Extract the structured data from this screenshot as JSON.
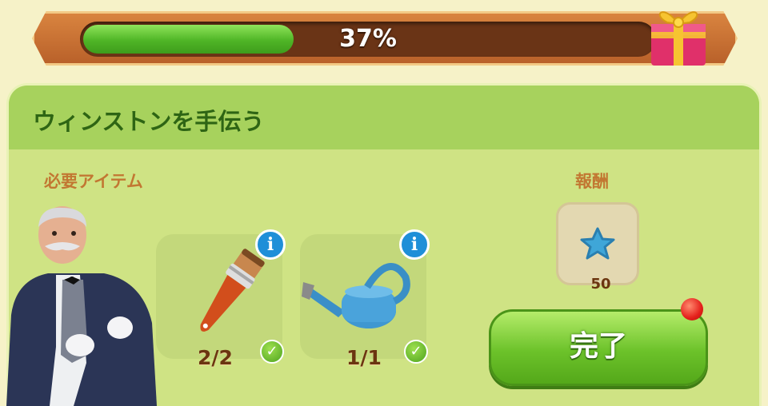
{
  "progress": {
    "percent_label": "37%",
    "fraction": 0.37
  },
  "panel": {
    "title": "ウィンストンを手伝う",
    "required_label": "必要アイテム",
    "reward_label": "報酬"
  },
  "items": [
    {
      "name": "paintbrush",
      "count": "2/2",
      "info": "i"
    },
    {
      "name": "watering-can",
      "count": "1/1",
      "info": "i"
    }
  ],
  "reward": {
    "icon": "blue-star-icon",
    "amount": "50"
  },
  "complete_button": {
    "label": "完了"
  },
  "colors": {
    "accent_green": "#6cc22a",
    "banner_orange": "#c96f33",
    "info_blue": "#1f8fd8",
    "notification_red": "#e4201b"
  }
}
